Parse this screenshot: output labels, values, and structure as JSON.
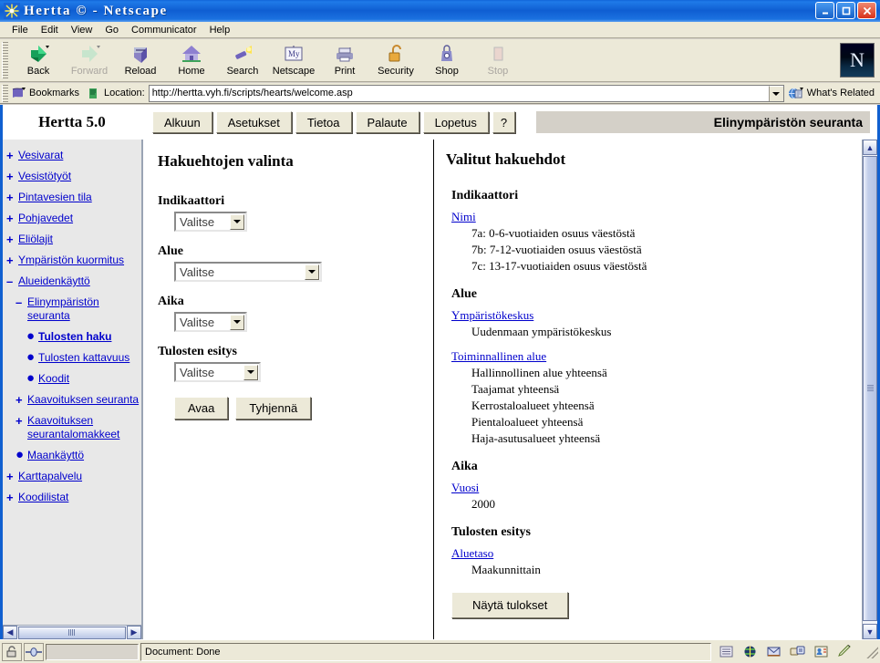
{
  "window": {
    "title": "Hertta © - Netscape",
    "icon": "hertta-app-icon",
    "buttons": {
      "minimize": "–",
      "maximize": "□",
      "close": "✕"
    }
  },
  "menubar": {
    "items": [
      "File",
      "Edit",
      "View",
      "Go",
      "Communicator",
      "Help"
    ]
  },
  "toolbar": {
    "buttons": [
      {
        "label": "Back",
        "icon": "back-arrow-icon",
        "enabled": true
      },
      {
        "label": "Forward",
        "icon": "forward-arrow-icon",
        "enabled": false
      },
      {
        "label": "Reload",
        "icon": "reload-icon",
        "enabled": true
      },
      {
        "label": "Home",
        "icon": "home-icon",
        "enabled": true
      },
      {
        "label": "Search",
        "icon": "flashlight-search-icon",
        "enabled": true
      },
      {
        "label": "Netscape",
        "icon": "my-netscape-icon",
        "enabled": true
      },
      {
        "label": "Print",
        "icon": "printer-icon",
        "enabled": true
      },
      {
        "label": "Security",
        "icon": "padlock-icon",
        "enabled": true
      },
      {
        "label": "Shop",
        "icon": "shopping-bag-icon",
        "enabled": true
      },
      {
        "label": "Stop",
        "icon": "stop-sign-icon",
        "enabled": false
      }
    ],
    "logo": "N"
  },
  "locationbar": {
    "bookmarks_label": "Bookmarks",
    "location_label": "Location:",
    "url": "http://hertta.vyh.fi/scripts/hearts/welcome.asp",
    "whats_related_label": "What's Related"
  },
  "app": {
    "brand": "Hertta 5.0",
    "tabs": [
      "Alkuun",
      "Asetukset",
      "Tietoa",
      "Palaute",
      "Lopetus",
      "?"
    ],
    "section_title": "Elinympäristön seuranta"
  },
  "sidebar": {
    "items": [
      {
        "label": "Vesivarat",
        "mark": "+",
        "level": 0,
        "current": false
      },
      {
        "label": "Vesistötyöt",
        "mark": "+",
        "level": 0,
        "current": false
      },
      {
        "label": "Pintavesien tila",
        "mark": "+",
        "level": 0,
        "current": false
      },
      {
        "label": "Pohjavedet",
        "mark": "+",
        "level": 0,
        "current": false
      },
      {
        "label": "Eliölajit",
        "mark": "+",
        "level": 0,
        "current": false
      },
      {
        "label": "Ympäristön kuormitus",
        "mark": "+",
        "level": 0,
        "current": false
      },
      {
        "label": "Alueidenkäyttö",
        "mark": "–",
        "level": 0,
        "current": false
      },
      {
        "label": "Elinympäristön seuranta",
        "mark": "–",
        "level": 1,
        "current": false
      },
      {
        "label": "Tulosten haku",
        "mark": "●",
        "level": 2,
        "current": true
      },
      {
        "label": "Tulosten kattavuus",
        "mark": "●",
        "level": 2,
        "current": false
      },
      {
        "label": "Koodit",
        "mark": "●",
        "level": 2,
        "current": false
      },
      {
        "label": "Kaavoituksen seuranta",
        "mark": "+",
        "level": 1,
        "current": false
      },
      {
        "label": "Kaavoituksen seurantalomakkeet",
        "mark": "+",
        "level": 1,
        "current": false
      },
      {
        "label": "Maankäyttö",
        "mark": "●",
        "level": 1,
        "current": false
      },
      {
        "label": "Karttapalvelu",
        "mark": "+",
        "level": 0,
        "current": false
      },
      {
        "label": "Koodilistat",
        "mark": "+",
        "level": 0,
        "current": false
      }
    ]
  },
  "form": {
    "heading": "Hakuehtojen valinta",
    "fields": [
      {
        "label": "Indikaattori",
        "value": "Valitse",
        "width": "sel-w1"
      },
      {
        "label": "Alue",
        "value": "Valitse",
        "width": "sel-w2"
      },
      {
        "label": "Aika",
        "value": "Valitse",
        "width": "sel-w1"
      },
      {
        "label": "Tulosten esitys",
        "value": "Valitse",
        "width": "sel-w3"
      }
    ],
    "open_button": "Avaa",
    "clear_button": "Tyhjennä"
  },
  "criteria": {
    "heading": "Valitut hakuehdot",
    "sections": [
      {
        "head": "Indikaattori",
        "groups": [
          {
            "link": "Nimi",
            "values": [
              "7a:  0-6-vuotiaiden osuus väestöstä",
              "7b:  7-12-vuotiaiden osuus väestöstä",
              "7c:  13-17-vuotiaiden osuus väestöstä"
            ]
          }
        ]
      },
      {
        "head": "Alue",
        "groups": [
          {
            "link": "Ympäristökeskus",
            "values": [
              "Uudenmaan ympäristökeskus"
            ]
          },
          {
            "link": "Toiminnallinen alue",
            "values": [
              "Hallinnollinen alue yhteensä",
              "Taajamat yhteensä",
              "Kerrostaloalueet yhteensä",
              "Pientaloalueet yhteensä",
              "Haja-asutusalueet yhteensä"
            ]
          }
        ]
      },
      {
        "head": "Aika",
        "groups": [
          {
            "link": "Vuosi",
            "values": [
              "2000"
            ]
          }
        ]
      },
      {
        "head": "Tulosten esitys",
        "groups": [
          {
            "link": "Aluetaso",
            "values": [
              "Maakunnittain"
            ]
          }
        ]
      }
    ],
    "show_results_button": "Näytä tulokset"
  },
  "statusbar": {
    "message": "Document: Done",
    "lock_icon": "padlock-icon",
    "connection_icon": "connection-icon",
    "components": [
      "sidebar-tab-icon",
      "navigator-icon",
      "mail-icon",
      "composer-icon",
      "address-book-icon",
      "pencil-icon"
    ]
  },
  "colors": {
    "title_bar": "#1060d0",
    "chrome": "#ece9d8",
    "link": "#0000cc",
    "band": "#d4d0c8",
    "scrollbar": "#b9c6e6"
  }
}
